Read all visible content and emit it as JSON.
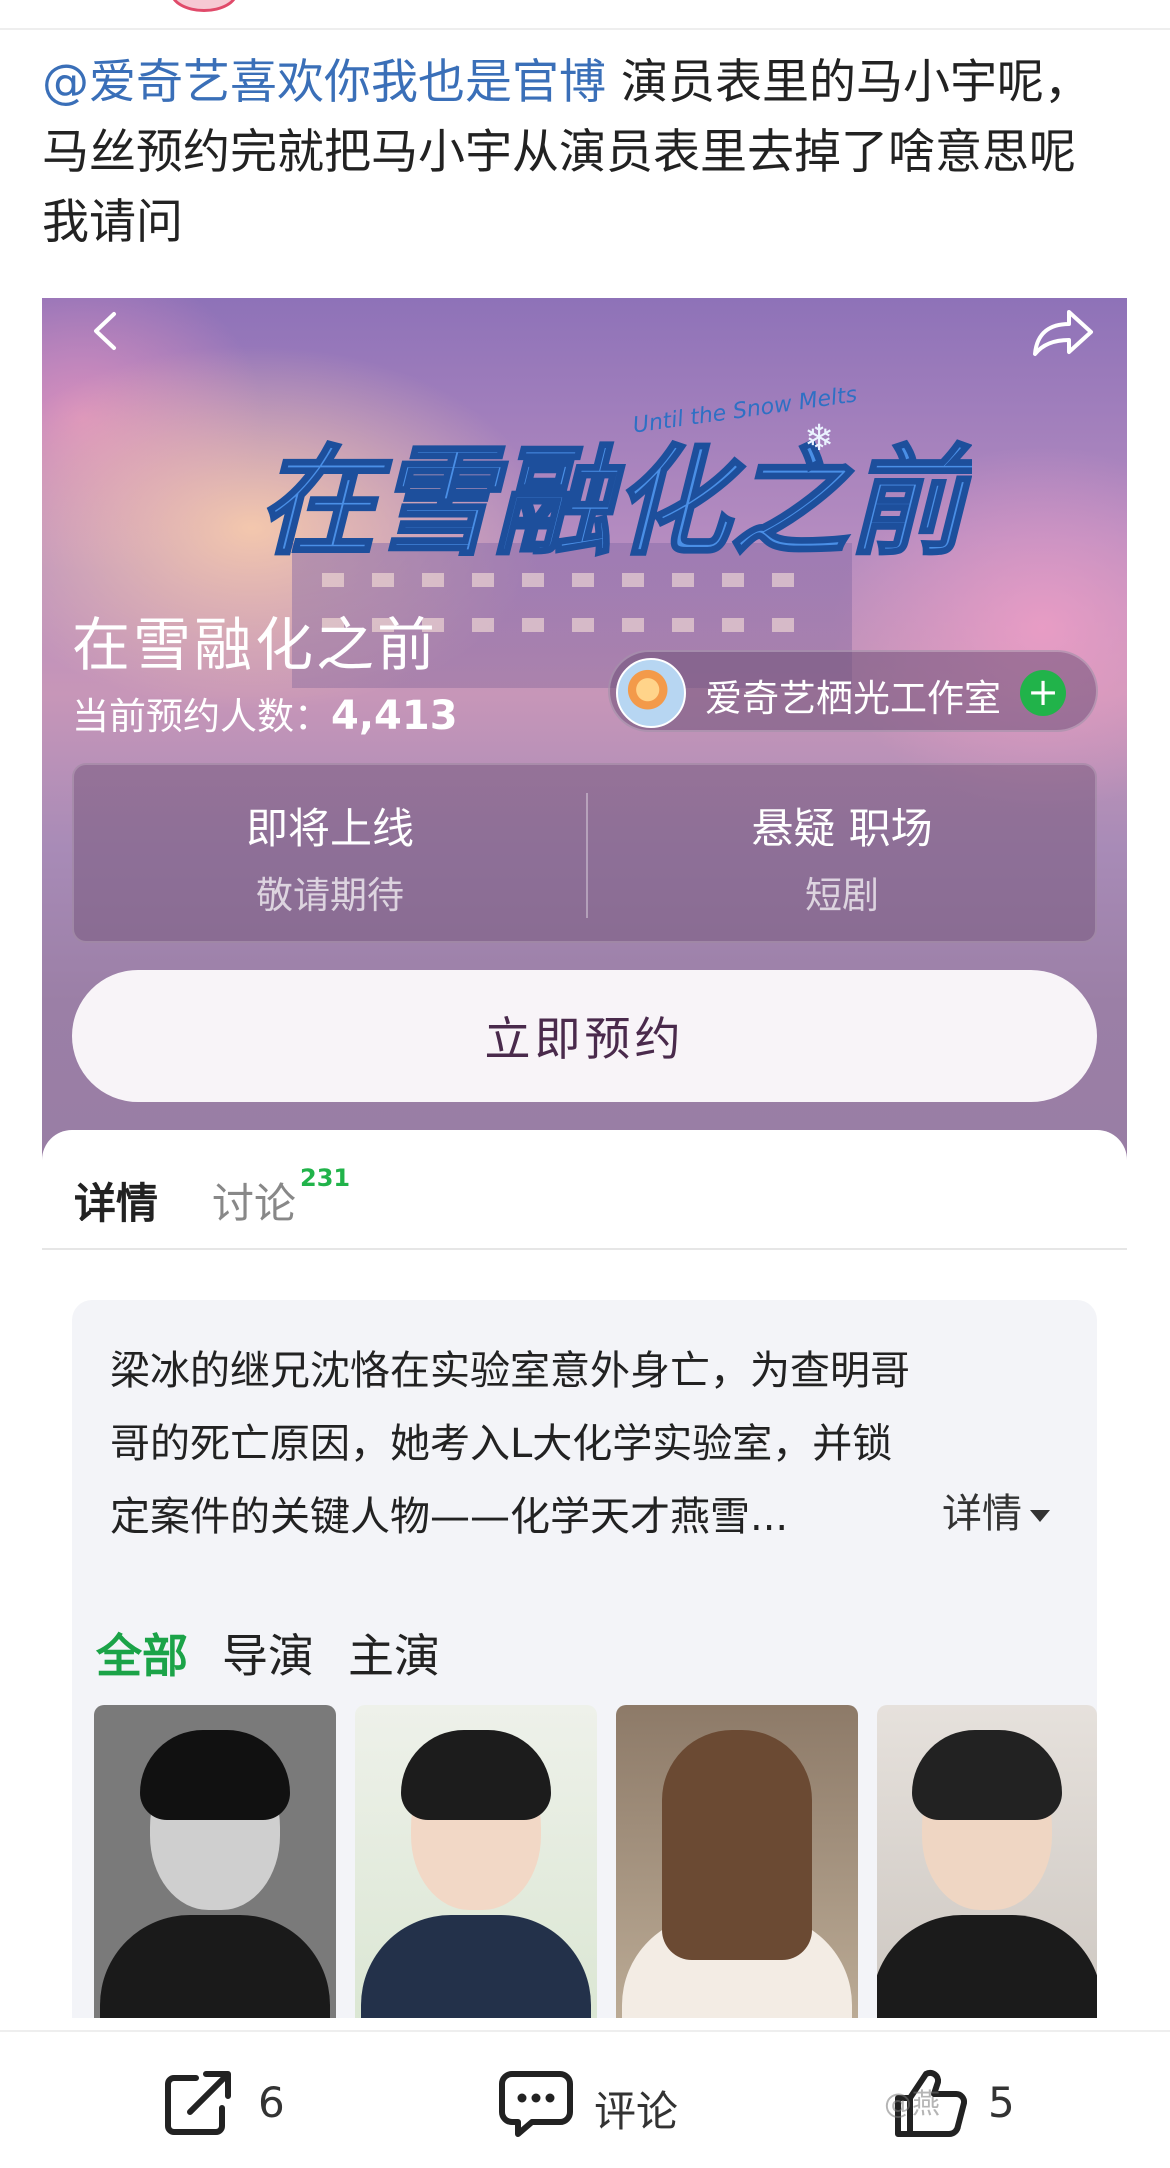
{
  "post": {
    "mention": "@爱奇艺喜欢你我也是官博",
    "text_line1": " 演员表里的马小宇呢，",
    "text_line2": "马丝预约完就把马小宇从演员表里去掉了啥意思呢",
    "text_line3": "我请问"
  },
  "card": {
    "logo_text": "在雪融化之前",
    "logo_subtitle": "Until the Snow Melts",
    "drama_title": "在雪融化之前",
    "reserve_label": "当前预约人数：",
    "reserve_count": "4,413",
    "studio_name": "爱奇艺栖光工作室",
    "studio_follow": "+",
    "info_left_main": "即将上线",
    "info_left_sub": "敬请期待",
    "info_right_main": "悬疑 职场",
    "info_right_sub": "短剧",
    "reserve_button": "立即预约"
  },
  "tabs": {
    "details": "详情",
    "discussion": "讨论",
    "discussion_count": "231"
  },
  "detail": {
    "synopsis_line1": "梁冰的继兄沈恪在实验室意外身亡，为查明哥",
    "synopsis_line2": "哥的死亡原因，她考入L大化学实验室，并锁",
    "synopsis_line3": "定案件的关键人物——化学天才燕雪...",
    "more_link": "详情",
    "filters": [
      "全部",
      "导演",
      "主演"
    ]
  },
  "bottom_bar": {
    "share_count": "6",
    "comment_label": "评论",
    "like_count": "5"
  },
  "watermark": "@燕",
  "colors": {
    "mention": "#3a6fb8",
    "accent_green": "#1ba348",
    "button_text": "#4a2a4c"
  },
  "icons": [
    "back-arrow-icon",
    "share-arrow-icon",
    "plus-icon",
    "caret-down-icon",
    "repost-icon",
    "comment-icon",
    "thumbs-up-icon"
  ]
}
